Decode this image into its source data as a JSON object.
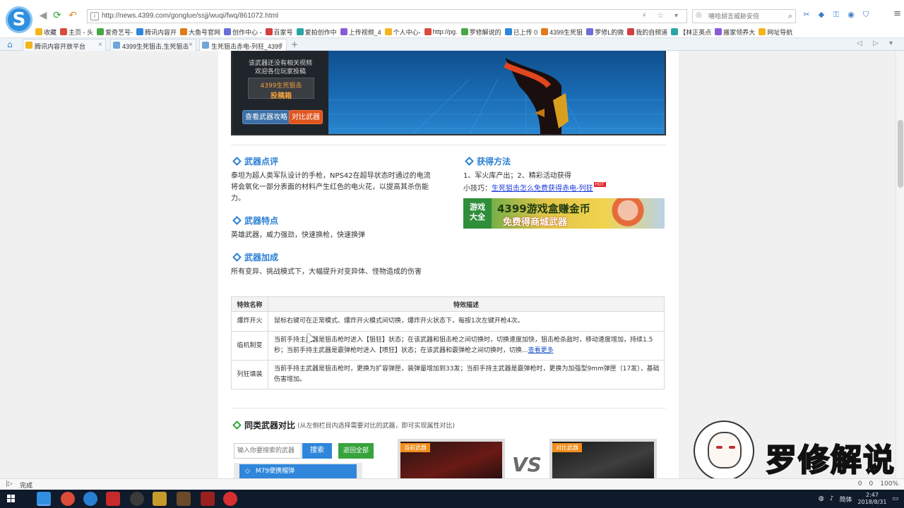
{
  "browser": {
    "logo_letter": "S",
    "url": "http://news.4399.com/gonglue/ssjj/wuqi/fwq/861072.html",
    "search_placeholder": "嘻哈胡言威胁安倍",
    "bookmarks": [
      "收藏",
      "主页 - 头",
      "爱奇艺号-",
      "腾讯内容开",
      "大鱼号官网",
      "创作中心 -",
      "百家号",
      "爱拍创作中",
      "上传视频_4",
      "个人中心-",
      "http://pg.",
      "罗修解说的",
      "已上传 0",
      "4399生死狙",
      "罗修L的微",
      "我的自频道",
      "【林正英点",
      "搬家领养大",
      "网址导航"
    ],
    "tabs": [
      {
        "label": "腾讯内容开放平台"
      },
      {
        "label": "4399生死狙击,生死狙击"
      },
      {
        "label": "生死狙击赤电-列狂_4399"
      }
    ]
  },
  "banner": {
    "note_line1": "该武器还没有相关视频",
    "note_line2": "欢迎各位玩家投稿",
    "tougao_top": "4399生死狙击",
    "tougao_bottom": "投稿箱",
    "btn_guide": "查看武器攻略",
    "btn_compare": "对比武器"
  },
  "sections": {
    "review_title": "武器点评",
    "review_text": "泰坦为超人类军队设计的手枪，NPS42在超导状态时通过的电流将会氧化一部分表面的材料产生红色的电火花，以提高其杀伤能力。",
    "features_title": "武器特点",
    "features_text": "英雄武器，威力强劲，快速换枪，快速换弹",
    "bonus_title": "武器加成",
    "bonus_text": "所有变异、挑战模式下，大幅提升对变异体、怪物造成的伤害",
    "obtain_title": "获得方法",
    "obtain_text": "1、军火库产出；2、精彩活动获得",
    "tip_prefix": "小技巧：",
    "tip_link": "生死狙击怎么免费获得赤电-列狂",
    "tip_badge": "HOT"
  },
  "ad": {
    "left_line1": "游戏",
    "left_line2": "大全",
    "line1": "4399游戏盒赚金币",
    "line2": "免费得商城武器"
  },
  "effects_table": {
    "headers": [
      "特效名称",
      "特效描述"
    ],
    "rows": [
      {
        "name": "爆炸开火",
        "desc": "鼠标右键可在正常模式、爆炸开火模式间切换，爆炸开火状态下，每按1次左键开枪4次。",
        "more": ""
      },
      {
        "name": "临机制变",
        "desc": "当前手持主武器是狙击枪时进入【狙狂】状态；在该武器和狙击枪之间切换时，切换速度加快，狙击枪杀敌时，移动速度增加，持续1.5秒；当前手持主武器是霰弹枪时进入【喷狂】状态；在该武器和霰弹枪之间切换时，切换...",
        "more": "查看更多"
      },
      {
        "name": "列狂填装",
        "desc": "当前手持主武器是狙击枪时，更换为扩容弹匣，装弹量增加到33发；当前手持主武器是霰弹枪时，更换为加强型9mm弹匣（17发），基础伤害增加。",
        "more": ""
      }
    ]
  },
  "compare": {
    "title": "同类武器对比",
    "subtitle": "(从左侧栏目内选择需要对比的武器，即可实现属性对比)",
    "search_placeholder": "输入你要搜索的武器",
    "btn_search": "搜索",
    "btn_return": "返回全部",
    "list_item": "M79便携榴弹",
    "list_bullet": "◇",
    "current_tag": "当前武器",
    "compare_tag": "对比武器",
    "vs": "VS"
  },
  "watermark": {
    "text": "罗修解说"
  },
  "status": {
    "text": "完成",
    "right": [
      "0",
      "0",
      "100%"
    ]
  },
  "taskbar": {
    "ime": "简体",
    "time": "2:47",
    "date": "2018/8/31"
  },
  "colors": {
    "accent_blue": "#2b7fd3",
    "accent_green": "#37a33c",
    "accent_orange": "#e0531c",
    "link": "#1a39d9"
  }
}
